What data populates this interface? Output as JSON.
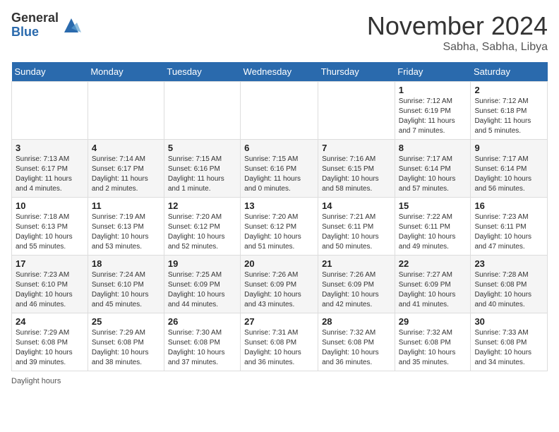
{
  "header": {
    "logo_general": "General",
    "logo_blue": "Blue",
    "month_title": "November 2024",
    "location": "Sabha, Sabha, Libya"
  },
  "days_of_week": [
    "Sunday",
    "Monday",
    "Tuesday",
    "Wednesday",
    "Thursday",
    "Friday",
    "Saturday"
  ],
  "weeks": [
    [
      {
        "num": "",
        "info": ""
      },
      {
        "num": "",
        "info": ""
      },
      {
        "num": "",
        "info": ""
      },
      {
        "num": "",
        "info": ""
      },
      {
        "num": "",
        "info": ""
      },
      {
        "num": "1",
        "info": "Sunrise: 7:12 AM\nSunset: 6:19 PM\nDaylight: 11 hours and 7 minutes."
      },
      {
        "num": "2",
        "info": "Sunrise: 7:12 AM\nSunset: 6:18 PM\nDaylight: 11 hours and 5 minutes."
      }
    ],
    [
      {
        "num": "3",
        "info": "Sunrise: 7:13 AM\nSunset: 6:17 PM\nDaylight: 11 hours and 4 minutes."
      },
      {
        "num": "4",
        "info": "Sunrise: 7:14 AM\nSunset: 6:17 PM\nDaylight: 11 hours and 2 minutes."
      },
      {
        "num": "5",
        "info": "Sunrise: 7:15 AM\nSunset: 6:16 PM\nDaylight: 11 hours and 1 minute."
      },
      {
        "num": "6",
        "info": "Sunrise: 7:15 AM\nSunset: 6:16 PM\nDaylight: 11 hours and 0 minutes."
      },
      {
        "num": "7",
        "info": "Sunrise: 7:16 AM\nSunset: 6:15 PM\nDaylight: 10 hours and 58 minutes."
      },
      {
        "num": "8",
        "info": "Sunrise: 7:17 AM\nSunset: 6:14 PM\nDaylight: 10 hours and 57 minutes."
      },
      {
        "num": "9",
        "info": "Sunrise: 7:17 AM\nSunset: 6:14 PM\nDaylight: 10 hours and 56 minutes."
      }
    ],
    [
      {
        "num": "10",
        "info": "Sunrise: 7:18 AM\nSunset: 6:13 PM\nDaylight: 10 hours and 55 minutes."
      },
      {
        "num": "11",
        "info": "Sunrise: 7:19 AM\nSunset: 6:13 PM\nDaylight: 10 hours and 53 minutes."
      },
      {
        "num": "12",
        "info": "Sunrise: 7:20 AM\nSunset: 6:12 PM\nDaylight: 10 hours and 52 minutes."
      },
      {
        "num": "13",
        "info": "Sunrise: 7:20 AM\nSunset: 6:12 PM\nDaylight: 10 hours and 51 minutes."
      },
      {
        "num": "14",
        "info": "Sunrise: 7:21 AM\nSunset: 6:11 PM\nDaylight: 10 hours and 50 minutes."
      },
      {
        "num": "15",
        "info": "Sunrise: 7:22 AM\nSunset: 6:11 PM\nDaylight: 10 hours and 49 minutes."
      },
      {
        "num": "16",
        "info": "Sunrise: 7:23 AM\nSunset: 6:11 PM\nDaylight: 10 hours and 47 minutes."
      }
    ],
    [
      {
        "num": "17",
        "info": "Sunrise: 7:23 AM\nSunset: 6:10 PM\nDaylight: 10 hours and 46 minutes."
      },
      {
        "num": "18",
        "info": "Sunrise: 7:24 AM\nSunset: 6:10 PM\nDaylight: 10 hours and 45 minutes."
      },
      {
        "num": "19",
        "info": "Sunrise: 7:25 AM\nSunset: 6:09 PM\nDaylight: 10 hours and 44 minutes."
      },
      {
        "num": "20",
        "info": "Sunrise: 7:26 AM\nSunset: 6:09 PM\nDaylight: 10 hours and 43 minutes."
      },
      {
        "num": "21",
        "info": "Sunrise: 7:26 AM\nSunset: 6:09 PM\nDaylight: 10 hours and 42 minutes."
      },
      {
        "num": "22",
        "info": "Sunrise: 7:27 AM\nSunset: 6:09 PM\nDaylight: 10 hours and 41 minutes."
      },
      {
        "num": "23",
        "info": "Sunrise: 7:28 AM\nSunset: 6:08 PM\nDaylight: 10 hours and 40 minutes."
      }
    ],
    [
      {
        "num": "24",
        "info": "Sunrise: 7:29 AM\nSunset: 6:08 PM\nDaylight: 10 hours and 39 minutes."
      },
      {
        "num": "25",
        "info": "Sunrise: 7:29 AM\nSunset: 6:08 PM\nDaylight: 10 hours and 38 minutes."
      },
      {
        "num": "26",
        "info": "Sunrise: 7:30 AM\nSunset: 6:08 PM\nDaylight: 10 hours and 37 minutes."
      },
      {
        "num": "27",
        "info": "Sunrise: 7:31 AM\nSunset: 6:08 PM\nDaylight: 10 hours and 36 minutes."
      },
      {
        "num": "28",
        "info": "Sunrise: 7:32 AM\nSunset: 6:08 PM\nDaylight: 10 hours and 36 minutes."
      },
      {
        "num": "29",
        "info": "Sunrise: 7:32 AM\nSunset: 6:08 PM\nDaylight: 10 hours and 35 minutes."
      },
      {
        "num": "30",
        "info": "Sunrise: 7:33 AM\nSunset: 6:08 PM\nDaylight: 10 hours and 34 minutes."
      }
    ]
  ],
  "footer": {
    "note": "Daylight hours"
  }
}
